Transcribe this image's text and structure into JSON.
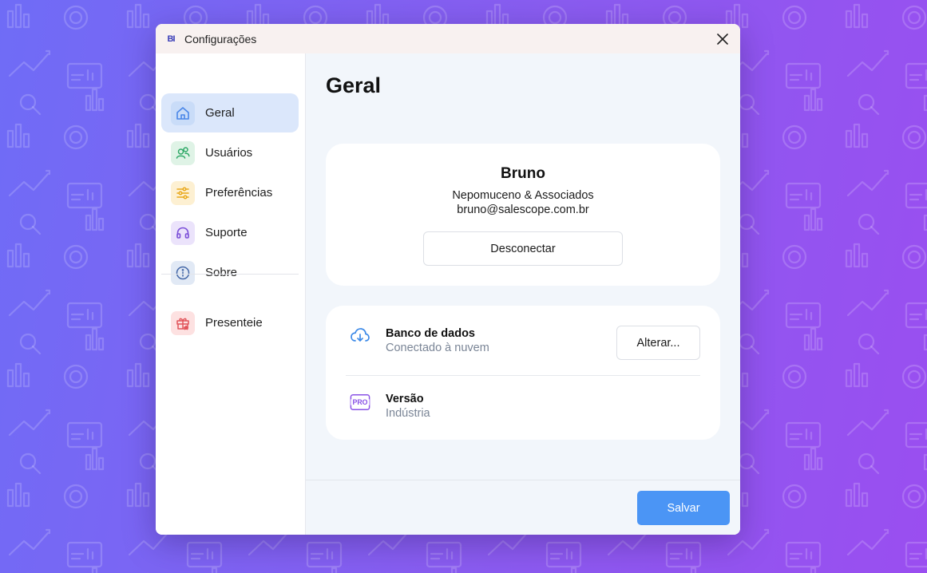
{
  "window": {
    "title": "Configurações",
    "logo_text": "BI"
  },
  "sidebar": {
    "items": [
      {
        "label": "Geral",
        "icon": "home-icon",
        "active": true
      },
      {
        "label": "Usuários",
        "icon": "users-icon",
        "active": false
      },
      {
        "label": "Preferências",
        "icon": "sliders-icon",
        "active": false
      },
      {
        "label": "Suporte",
        "icon": "headset-icon",
        "active": false
      },
      {
        "label": "Sobre",
        "icon": "info-icon",
        "active": false
      },
      {
        "label": "Presenteie",
        "icon": "gift-icon",
        "active": false
      }
    ]
  },
  "main": {
    "title": "Geral",
    "profile": {
      "name": "Bruno",
      "company": "Nepomuceno & Associados",
      "email": "bruno@salescope.com.br",
      "disconnect_label": "Desconectar"
    },
    "database": {
      "title": "Banco de dados",
      "status": "Conectado à nuvem",
      "change_label": "Alterar...",
      "icon": "cloud-download-icon"
    },
    "version": {
      "title": "Versão",
      "value": "Indústria",
      "icon": "pro-badge-icon",
      "badge_text": "PRO"
    }
  },
  "footer": {
    "save_label": "Salvar"
  },
  "colors": {
    "accent": "#4b95f5",
    "active_nav": "#dbe7fb",
    "background_gradient_start": "#6f6cf6",
    "background_gradient_end": "#9a4ef0"
  }
}
